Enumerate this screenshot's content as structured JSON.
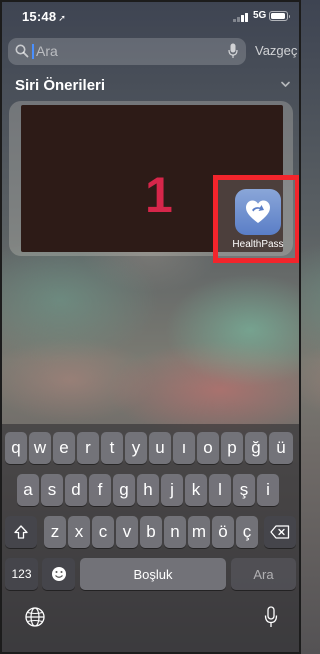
{
  "status_bar": {
    "time": "15:48",
    "network": "5G"
  },
  "search": {
    "placeholder": "Ara",
    "cancel_label": "Vazgeç"
  },
  "siri": {
    "title": "Siri Önerileri",
    "video_number": "1"
  },
  "app": {
    "name": "HealthPass",
    "icon_color": "#6f8fd0"
  },
  "highlight_color": "#f2252c",
  "keyboard": {
    "row1": [
      "q",
      "w",
      "e",
      "r",
      "t",
      "y",
      "u",
      "ı",
      "o",
      "p",
      "ğ",
      "ü"
    ],
    "row2": [
      "a",
      "s",
      "d",
      "f",
      "g",
      "h",
      "j",
      "k",
      "l",
      "ş",
      "i"
    ],
    "row3": [
      "z",
      "x",
      "c",
      "v",
      "b",
      "n",
      "m",
      "ö",
      "ç"
    ],
    "numbers_label": "123",
    "space_label": "Boşluk",
    "return_label": "Ara"
  }
}
